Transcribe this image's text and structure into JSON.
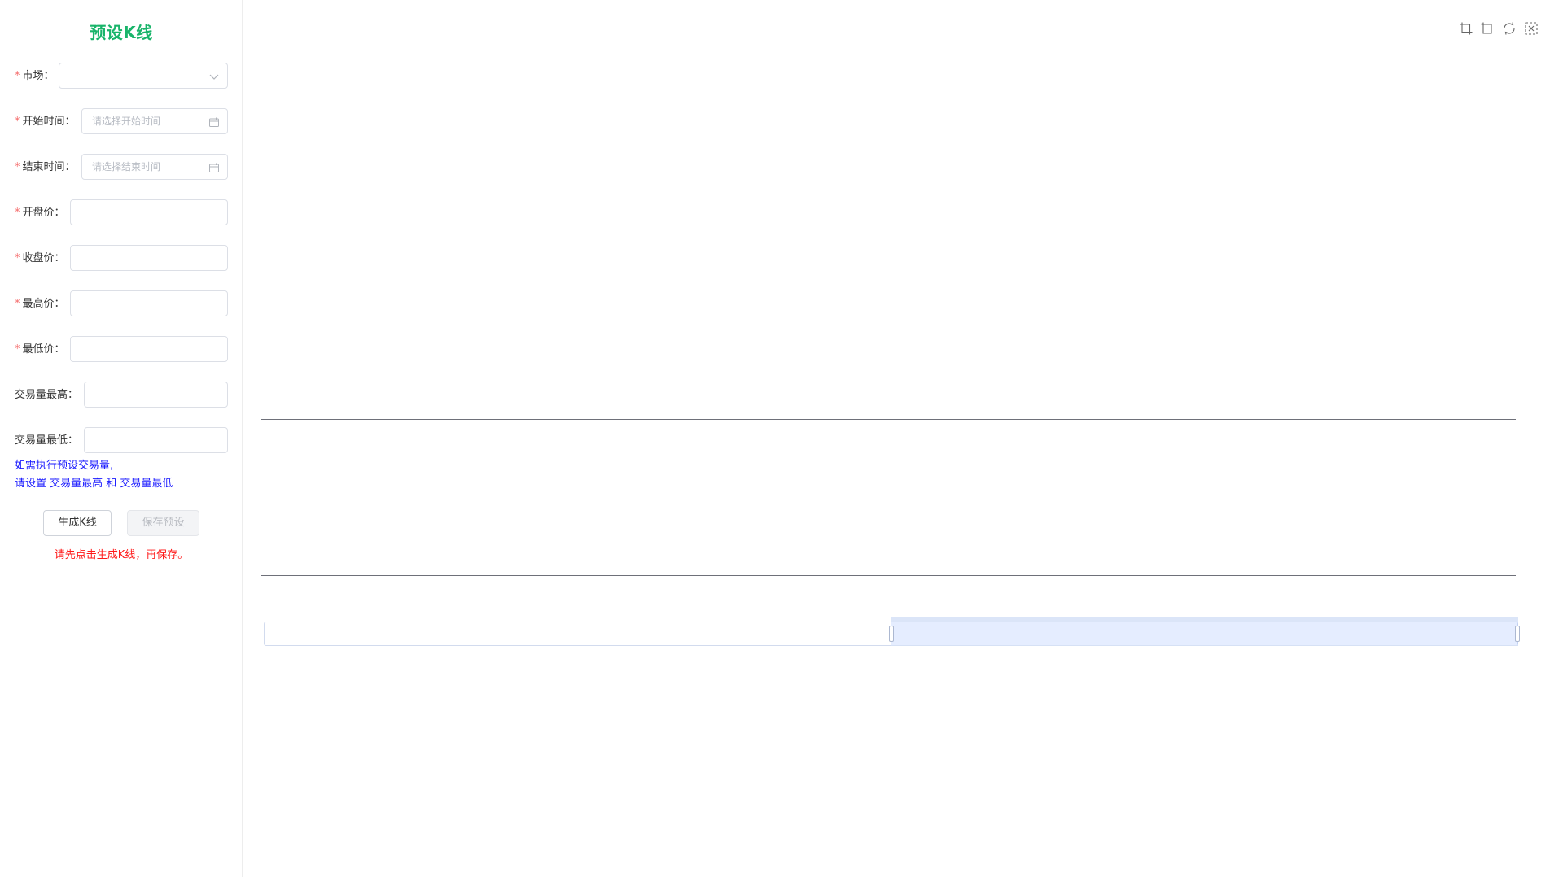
{
  "form": {
    "title": "预设K线",
    "required_mark": "*",
    "fields": [
      {
        "label": "市场：",
        "value": "",
        "placeholder": "",
        "suffix_icon": "chevron-down-icon"
      },
      {
        "label": "开始时间：",
        "value": "",
        "placeholder": "请选择开始时间",
        "suffix_icon": "calendar-icon"
      },
      {
        "label": "结束时间：",
        "value": "",
        "placeholder": "请选择结束时间",
        "suffix_icon": "calendar-icon"
      },
      {
        "label": "开盘价：",
        "value": ""
      },
      {
        "label": "收盘价：",
        "value": ""
      },
      {
        "label": "最高价：",
        "value": ""
      },
      {
        "label": "最低价：",
        "value": ""
      },
      {
        "label": "交易量最高：",
        "value": ""
      },
      {
        "label": "交易量最低：",
        "value": ""
      }
    ],
    "note_line1": "如需执行预设交易量,",
    "note_line2": "请设置 交易量最高 和 交易量最低",
    "generate_button": "生成K线",
    "save_button": "保存预设",
    "warning": "请先点击生成K线，再保存。"
  },
  "colors": {
    "title": "#19b46a",
    "required": "#f56c6c",
    "note": "#1a1aff",
    "warning": "#ff1a1a",
    "axis": "#6e7079",
    "slider_fill": "#dbe5f8"
  },
  "chart": {
    "toolbox_icons": [
      "zoom-area-icon",
      "zoom-reset-icon",
      "restore-icon",
      "save-image-icon"
    ],
    "zoom_range_percent": {
      "start": 50,
      "end": 100
    }
  }
}
